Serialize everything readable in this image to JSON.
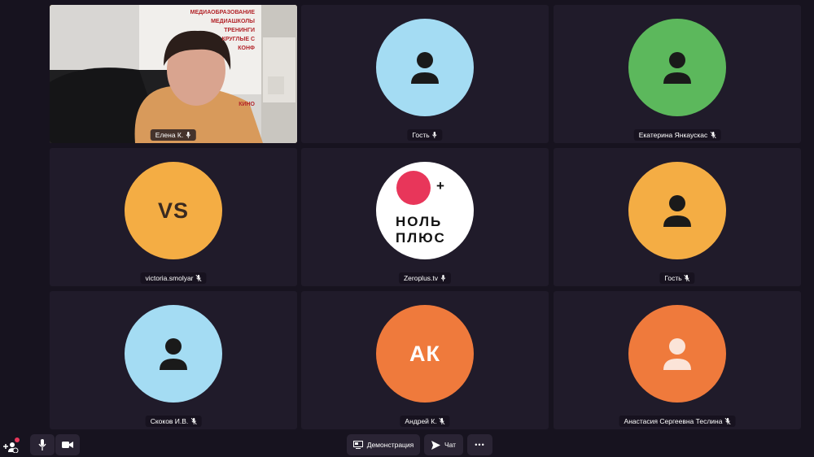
{
  "participants": [
    {
      "name": "Елена К.",
      "mic": "on",
      "kind": "video"
    },
    {
      "name": "Гость",
      "mic": "on",
      "kind": "icon",
      "bg": "#a4dcf3"
    },
    {
      "name": "Екатерина Янкаускас",
      "mic": "off",
      "kind": "icon",
      "bg": "#5cb85c"
    },
    {
      "name": "victoria.smolyar",
      "mic": "off",
      "kind": "initials",
      "initials": "VS",
      "bg": "#f4ad44"
    },
    {
      "name": "Zeroplus.tv",
      "mic": "on",
      "kind": "logo",
      "logo_line1": "НОЛЬ",
      "logo_line2": "ПЛЮС",
      "logo_plus": "+",
      "bg": "#ffffff"
    },
    {
      "name": "Гость",
      "mic": "off",
      "kind": "icon",
      "bg": "#f4ad44"
    },
    {
      "name": "Скоков И.В.",
      "mic": "off",
      "kind": "icon",
      "bg": "#a4dcf3"
    },
    {
      "name": "Андрей К.",
      "mic": "off",
      "kind": "initials",
      "initials": "АК",
      "bg": "#ef7a3c"
    },
    {
      "name": "Анастасия Сергеевна Теслина",
      "mic": "off",
      "kind": "icon-light",
      "bg": "#ef7a3c"
    }
  ],
  "video_poster_lines": [
    "МЕДИАОБРАЗОВАНИЕ",
    "МЕДИАШКОЛЫ",
    "ТРЕНИНГИ",
    "КРУГЛЫЕ С",
    "КОНФ",
    "КИНО"
  ],
  "controls": {
    "demo_label": "Демонстрация",
    "chat_label": "Чат",
    "more_label": "•••"
  },
  "colors": {
    "active_border": "#f5c324",
    "logo_dot": "#e8365a"
  }
}
